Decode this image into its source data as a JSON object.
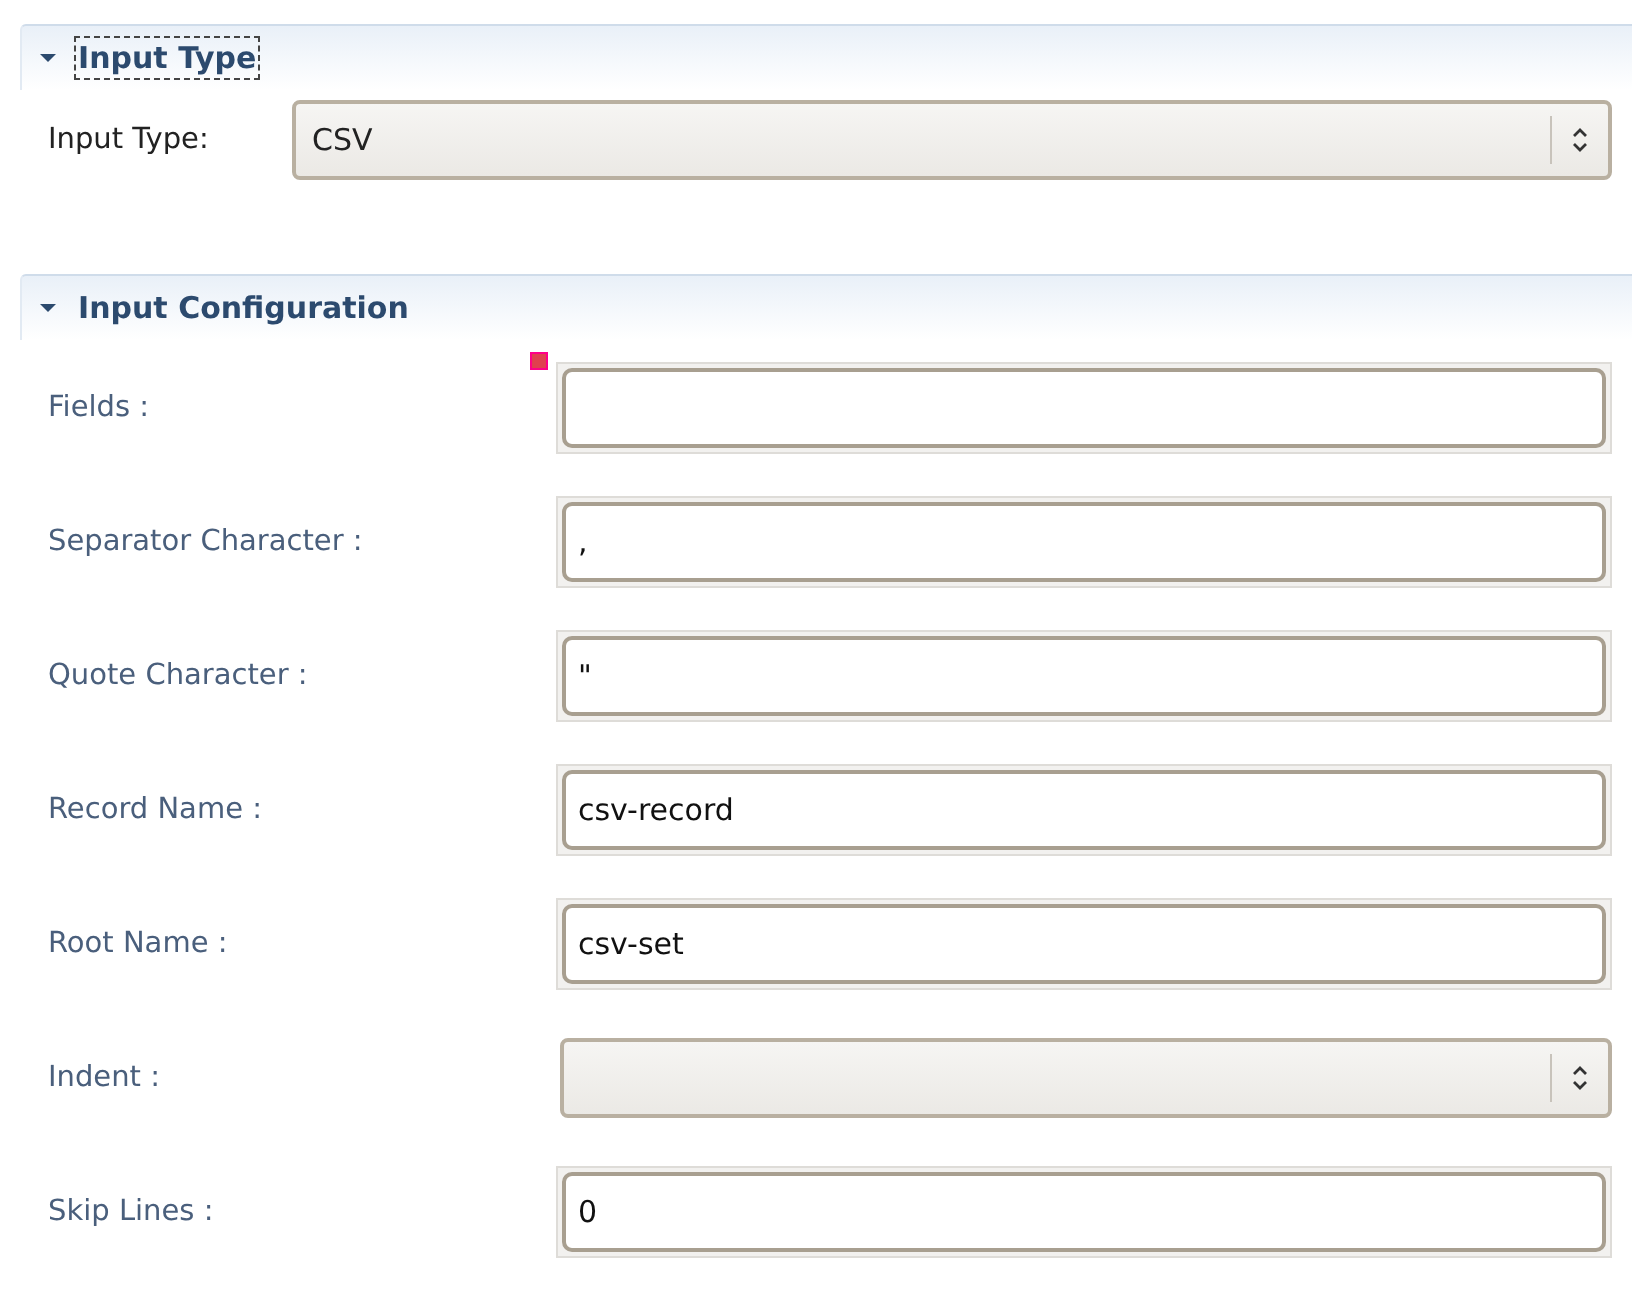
{
  "sections": [
    {
      "title": "Input Type",
      "expanded": true,
      "focused": true,
      "kind": "plain",
      "rows": [
        {
          "label": "Input Type:",
          "kind": "select",
          "value": "CSV",
          "error": false
        }
      ]
    },
    {
      "title": "Input Configuration",
      "expanded": true,
      "focused": false,
      "kind": "muted",
      "rows": [
        {
          "label": "Fields :",
          "kind": "text",
          "value": "",
          "error": true
        },
        {
          "label": "Separator Character :",
          "kind": "text",
          "value": ",",
          "error": false
        },
        {
          "label": "Quote Character :",
          "kind": "text",
          "value": "\"",
          "error": false
        },
        {
          "label": "Record Name :",
          "kind": "text",
          "value": "csv-record",
          "error": false
        },
        {
          "label": "Root Name :",
          "kind": "text",
          "value": "csv-set",
          "error": false
        },
        {
          "label": "Indent :",
          "kind": "select",
          "value": "",
          "error": false
        },
        {
          "label": "Skip Lines :",
          "kind": "text",
          "value": "0",
          "error": false
        }
      ]
    }
  ]
}
